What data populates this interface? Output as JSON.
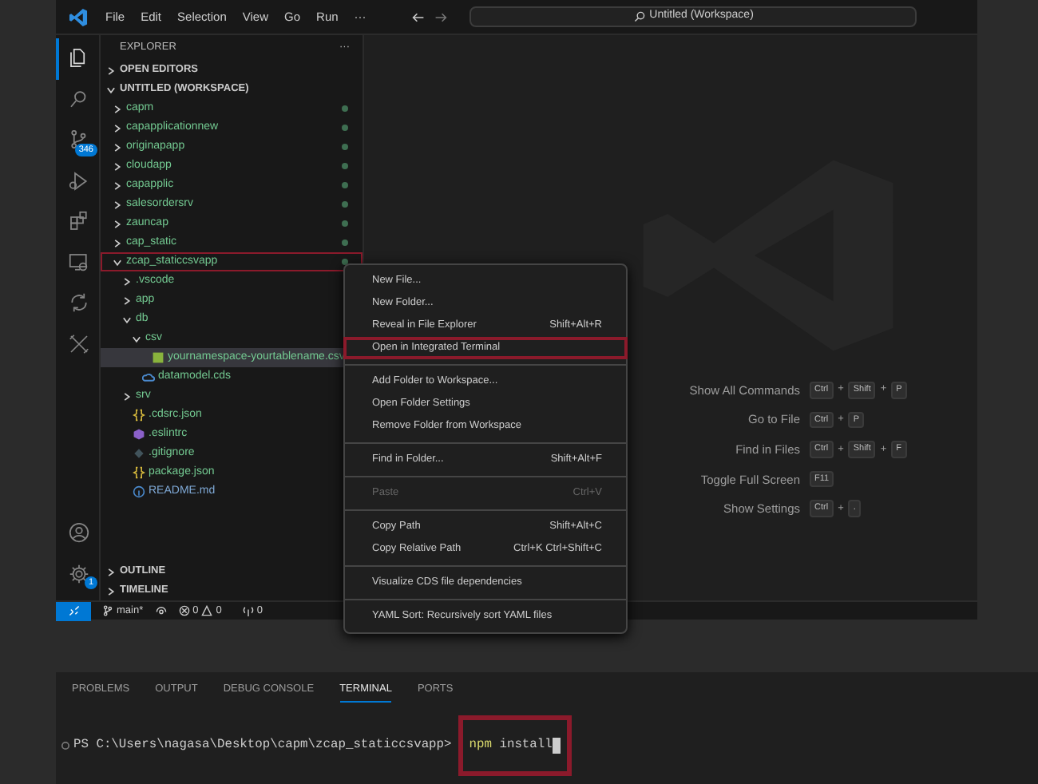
{
  "window": {
    "menu": [
      "File",
      "Edit",
      "Selection",
      "View",
      "Go",
      "Run",
      "···"
    ],
    "search": "Untitled (Workspace)"
  },
  "activity_bar": [
    {
      "kind": "files",
      "selected": true
    },
    {
      "kind": "search",
      "selected": false
    },
    {
      "kind": "source-control",
      "selected": false,
      "badge": "346"
    },
    {
      "kind": "run-debug",
      "selected": false
    },
    {
      "kind": "extensions",
      "selected": false
    },
    {
      "kind": "remote",
      "selected": false
    },
    {
      "kind": "cycle",
      "selected": false
    },
    {
      "kind": "tools",
      "selected": false
    }
  ],
  "activity_bottom": [
    {
      "kind": "account"
    },
    {
      "kind": "settings",
      "badge": "1"
    }
  ],
  "sidebar": {
    "title": "EXPLORER",
    "more": "···",
    "sections": [
      {
        "label": "OPEN EDITORS",
        "expanded": false
      },
      {
        "label": "UNTITLED (WORKSPACE)",
        "expanded": true
      }
    ],
    "tree": [
      {
        "label": "capm",
        "kind": "folder",
        "expanded": false,
        "selected": false,
        "highlighted": false,
        "git_dot": true,
        "color": "#73c991"
      },
      {
        "label": "capapplicationnew",
        "kind": "folder",
        "expanded": false,
        "selected": false,
        "highlighted": false,
        "git_dot": true,
        "color": "#73c991"
      },
      {
        "label": "originapapp",
        "kind": "folder",
        "expanded": false,
        "selected": false,
        "highlighted": false,
        "git_dot": true,
        "color": "#73c991"
      },
      {
        "label": "cloudapp",
        "kind": "folder",
        "expanded": false,
        "selected": false,
        "highlighted": false,
        "git_dot": true,
        "color": "#73c991"
      },
      {
        "label": "capapplic",
        "kind": "folder",
        "expanded": false,
        "selected": false,
        "highlighted": false,
        "git_dot": true,
        "color": "#73c991"
      },
      {
        "label": "salesordersrv",
        "kind": "folder",
        "expanded": false,
        "selected": false,
        "highlighted": false,
        "git_dot": true,
        "color": "#73c991"
      },
      {
        "label": "zauncap",
        "kind": "folder",
        "expanded": false,
        "selected": false,
        "highlighted": false,
        "git_dot": true,
        "color": "#73c991"
      },
      {
        "label": "cap_static",
        "kind": "folder",
        "expanded": false,
        "selected": false,
        "highlighted": false,
        "git_dot": true,
        "color": "#73c991"
      },
      {
        "label": "zcap_staticcsvapp",
        "kind": "folder",
        "expanded": true,
        "selected": false,
        "highlighted": true,
        "git_dot": true,
        "color": "#73c991",
        "children": [
          {
            "label": ".vscode",
            "kind": "folder",
            "expanded": false,
            "selected": false,
            "highlighted": false,
            "color": "#73c991"
          },
          {
            "label": "app",
            "kind": "folder",
            "expanded": false,
            "selected": false,
            "highlighted": false,
            "color": "#73c991"
          },
          {
            "label": "db",
            "kind": "folder",
            "expanded": true,
            "selected": false,
            "highlighted": false,
            "color": "#73c991",
            "children": [
              {
                "label": "csv",
                "kind": "folder",
                "expanded": true,
                "selected": false,
                "highlighted": false,
                "color": "#73c991",
                "children": [
                  {
                    "label": "yournamespace-yourtablename.csv",
                    "kind": "csv",
                    "selected": true,
                    "highlighted": false,
                    "color": "#73c991"
                  }
                ]
              },
              {
                "label": "datamodel.cds",
                "kind": "cds",
                "selected": false,
                "highlighted": false,
                "color": "#73c991"
              }
            ]
          },
          {
            "label": "srv",
            "kind": "folder",
            "expanded": false,
            "selected": false,
            "highlighted": false,
            "color": "#73c991"
          },
          {
            "label": ".cdsrc.json",
            "kind": "json",
            "selected": false,
            "highlighted": false,
            "color": "#73c991"
          },
          {
            "label": ".eslintrc",
            "kind": "eslint",
            "selected": false,
            "highlighted": false,
            "color": "#73c991"
          },
          {
            "label": ".gitignore",
            "kind": "git",
            "selected": false,
            "highlighted": false,
            "color": "#73c991"
          },
          {
            "label": "package.json",
            "kind": "json",
            "selected": false,
            "highlighted": false,
            "color": "#73c991"
          },
          {
            "label": "README.md",
            "kind": "info",
            "selected": false,
            "highlighted": false,
            "color": "#7fa9d6"
          }
        ]
      }
    ],
    "bottom_sections": [
      {
        "label": "OUTLINE",
        "expanded": false
      },
      {
        "label": "TIMELINE",
        "expanded": false
      }
    ]
  },
  "context_menu": [
    [
      {
        "label": "New File...",
        "disabled": false,
        "highlighted": false
      },
      {
        "label": "New Folder...",
        "disabled": false,
        "highlighted": false
      },
      {
        "label": "Reveal in File Explorer",
        "shortcut": "Shift+Alt+R",
        "disabled": false,
        "highlighted": false
      },
      {
        "label": "Open in Integrated Terminal",
        "disabled": false,
        "highlighted": true
      }
    ],
    [
      {
        "label": "Add Folder to Workspace...",
        "disabled": false,
        "highlighted": false
      },
      {
        "label": "Open Folder Settings",
        "disabled": false,
        "highlighted": false
      },
      {
        "label": "Remove Folder from Workspace",
        "disabled": false,
        "highlighted": false
      }
    ],
    [
      {
        "label": "Find in Folder...",
        "shortcut": "Shift+Alt+F",
        "disabled": false,
        "highlighted": false
      }
    ],
    [
      {
        "label": "Paste",
        "shortcut": "Ctrl+V",
        "disabled": true,
        "highlighted": false
      }
    ],
    [
      {
        "label": "Copy Path",
        "shortcut": "Shift+Alt+C",
        "disabled": false,
        "highlighted": false
      },
      {
        "label": "Copy Relative Path",
        "shortcut": "Ctrl+K Ctrl+Shift+C",
        "disabled": false,
        "highlighted": false
      }
    ],
    [
      {
        "label": "Visualize CDS file dependencies",
        "disabled": false,
        "highlighted": false
      }
    ],
    [
      {
        "label": "YAML Sort: Recursively sort YAML files",
        "disabled": false,
        "highlighted": false
      }
    ]
  ],
  "shortcuts": [
    {
      "label": "Show All Commands",
      "keys": [
        "Ctrl",
        "+",
        "Shift",
        "+",
        "P"
      ]
    },
    {
      "label": "Go to File",
      "keys": [
        "Ctrl",
        "+",
        "P"
      ]
    },
    {
      "label": "Find in Files",
      "keys": [
        "Ctrl",
        "+",
        "Shift",
        "+",
        "F"
      ]
    },
    {
      "label": "Toggle Full Screen",
      "keys": [
        "F11"
      ]
    },
    {
      "label": "Show Settings",
      "keys": [
        "Ctrl",
        "+",
        "."
      ]
    }
  ],
  "status_bar": {
    "branch": "main*",
    "errors": "0",
    "warnings": "0",
    "ports": "0"
  },
  "terminal": {
    "tabs": [
      {
        "label": "PROBLEMS",
        "selected": false
      },
      {
        "label": "OUTPUT",
        "selected": false
      },
      {
        "label": "DEBUG CONSOLE",
        "selected": false
      },
      {
        "label": "TERMINAL",
        "selected": true
      },
      {
        "label": "PORTS",
        "selected": false
      }
    ],
    "prompt": "PS C:\\Users\\nagasa\\Desktop\\capm\\zcap_staticcsvapp>",
    "command": "npm",
    "args": "install",
    "highlighted": true
  }
}
